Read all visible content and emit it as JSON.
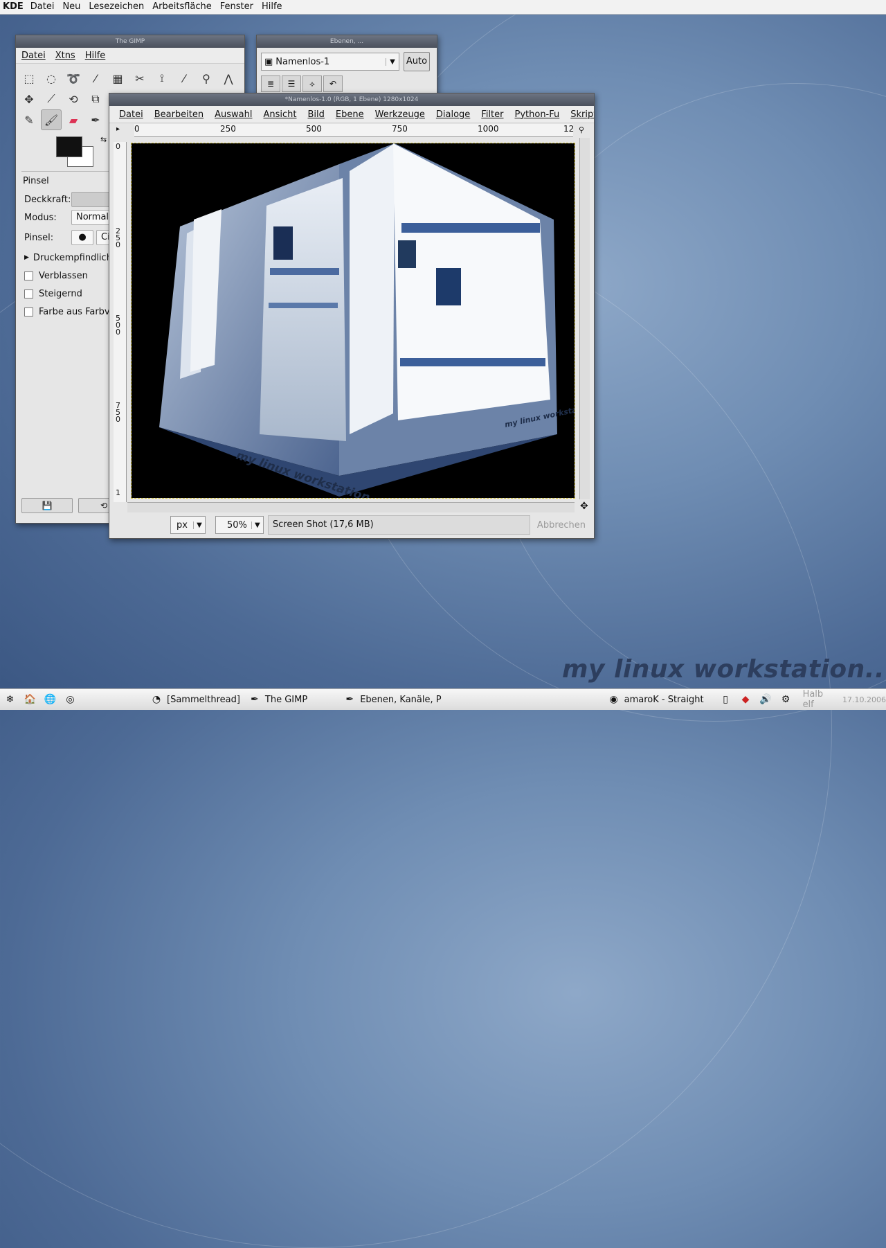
{
  "menubar": {
    "kde": "KDE",
    "items": [
      "Datei",
      "Neu",
      "Lesezeichen",
      "Arbeitsfläche",
      "Fenster",
      "Hilfe"
    ]
  },
  "toolbox": {
    "title": "The GIMP",
    "menu": [
      "Datei",
      "Xtns",
      "Hilfe"
    ],
    "options_title": "Pinsel",
    "opacity_label": "Deckkraft:",
    "mode_label": "Modus:",
    "mode_value": "Normal",
    "brush_label": "Pinsel:",
    "brush_value": "Circ",
    "pressure_label": "Druckempfindlich",
    "fade_label": "Verblassen",
    "increase_label": "Steigernd",
    "color_from_gradient_label": "Farbe aus Farbve"
  },
  "layers": {
    "title": "Ebenen, ...",
    "image_name": "Namenlos-1",
    "auto_label": "Auto"
  },
  "imagewin": {
    "title": "*Namenlos-1.0 (RGB, 1 Ebene) 1280x1024",
    "menu": [
      "Datei",
      "Bearbeiten",
      "Auswahl",
      "Ansicht",
      "Bild",
      "Ebene",
      "Werkzeuge",
      "Dialoge",
      "Filter",
      "Python-Fu",
      "Skript-Fu"
    ],
    "hruler": [
      "0",
      "250",
      "500",
      "750",
      "1000",
      "12"
    ],
    "vruler": [
      "0",
      "250",
      "500",
      "750",
      "1"
    ],
    "unit": "px",
    "zoom": "50%",
    "status": "Screen Shot (17,6 MB)",
    "cancel": "Abbrechen",
    "canvas_caption": "my linux workstation.."
  },
  "wordmark": "my linux workstation..",
  "taskbar": {
    "task1": "[Sammelthread]",
    "task2": "The GIMP",
    "task3": "Ebenen, Kanäle, P",
    "task4": "amaroK - Straight",
    "clock": "Halb elf",
    "date": "17.10.2006"
  }
}
